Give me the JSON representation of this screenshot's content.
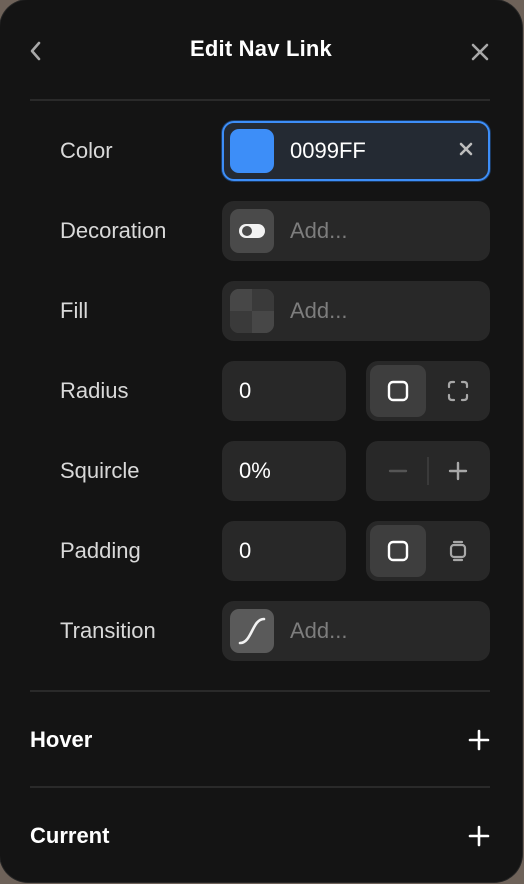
{
  "header": {
    "title": "Edit Nav Link",
    "back_icon": "chevron-left-icon",
    "close_icon": "close-icon"
  },
  "rows": {
    "color": {
      "label": "Color",
      "value": "0099FF",
      "swatch_color": "#3d8ef8"
    },
    "decoration": {
      "label": "Decoration",
      "placeholder": "Add...",
      "icon": "toggle-icon"
    },
    "fill": {
      "label": "Fill",
      "placeholder": "Add...",
      "icon": "checkerboard-icon"
    },
    "radius": {
      "label": "Radius",
      "value": "0",
      "mode_icons": [
        "square-icon",
        "corners-icon"
      ],
      "active_mode": 0
    },
    "squircle": {
      "label": "Squircle",
      "value": "0%",
      "stepper_icons": [
        "minus-icon",
        "plus-icon"
      ]
    },
    "padding": {
      "label": "Padding",
      "value": "0",
      "mode_icons": [
        "square-icon",
        "individual-sides-icon"
      ],
      "active_mode": 0
    },
    "transition": {
      "label": "Transition",
      "placeholder": "Add...",
      "icon": "ease-curve-icon"
    }
  },
  "sections": [
    {
      "title": "Hover",
      "action_icon": "plus-icon"
    },
    {
      "title": "Current",
      "action_icon": "plus-icon"
    }
  ],
  "colors": {
    "panel_bg": "#141414",
    "field_bg": "#282828",
    "accent": "#3d8ef8",
    "placeholder": "#7d7d7d",
    "label": "#d9d9d9"
  }
}
